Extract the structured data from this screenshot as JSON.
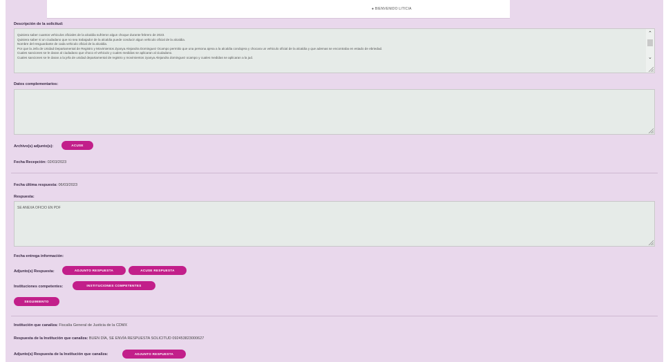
{
  "header": {
    "center_text": "BIENVENIDO LITICIA"
  },
  "descripcion": {
    "label": "Descripción de la solicitud:",
    "lines": [
      "Quisiera saber cuantos vehiculos oficiales de la alcaldia sufrieron algun choque durante febrero de 2023.",
      "Quisiera saber si un ciudadano que no sea trabajador de la alcaldia puede conducir algun vehiculo oficial de la alcaldia.",
      "Nombre del resguardante de cada vehiculo oficial de la alcaldia.",
      "Por que la Jefa de Unidad Departamental de Registro y Movimientos Zyanya Alejandra Dominguez Ocampo permitio que una persona ajena a la alcaldia condujera y chocara un vehiculo oficial de la alcaldia y que ademas se encontraba en estado de ebriedad.",
      "Cuales sanciones se le daran al ciudadano que choco el vehiculo y cuales medidas se aplicaran al ciudadano.",
      "Cuales sanciones se le daran a la jefa de unidad departamental de registro y movimientos zyanya Alejandra dominguez ocampo y cuales medidas se aplicaran a la jud."
    ]
  },
  "complementarios": {
    "label": "Datos complementarios:",
    "value": ""
  },
  "archivos": {
    "label": "Archivo(s) adjunto(s):",
    "button": "ACUSE"
  },
  "fecha_recepcion": {
    "label": "Fecha Recepción:",
    "value": "02/03/2023"
  },
  "fecha_ultima": {
    "label": "Fecha última respuesta:",
    "value": "06/03/2023"
  },
  "respuesta": {
    "label": "Respuesta:",
    "value": "SE ANEXA OFICIO EN PDF"
  },
  "fecha_entrega": {
    "label": "Fecha entrega información:"
  },
  "adjuntos_respuesta": {
    "label": "Adjunto(s) Respuesta:",
    "button1": "ADJUNTO RESPUESTA",
    "button2": "ACUSE RESPUESTA"
  },
  "instituciones": {
    "label": "Instituciones competentes:",
    "button": "INSTITUCIONES COMPETENTES"
  },
  "seguimiento": {
    "button": "SEGUIMIENTO"
  },
  "institucion_canaliza": {
    "label": "Institución que canaliza:",
    "value": "Fiscalía General de Justicia de la CDMX"
  },
  "respuesta_canaliza": {
    "label": "Respuesta de la Institución que canaliza:",
    "value": "BUEN DÍA, SE ENVÍA RESPUESTA SOLICITUD 092453823000627"
  },
  "adjuntos_canaliza": {
    "label": "Adjunto(s) Respuesta de la Institución que canaliza:",
    "button": "ADJUNTO RESPUESTA"
  },
  "colors": {
    "background": "#e9d8ec",
    "button": "#c21f8a",
    "textarea": "#e6ebe8"
  }
}
